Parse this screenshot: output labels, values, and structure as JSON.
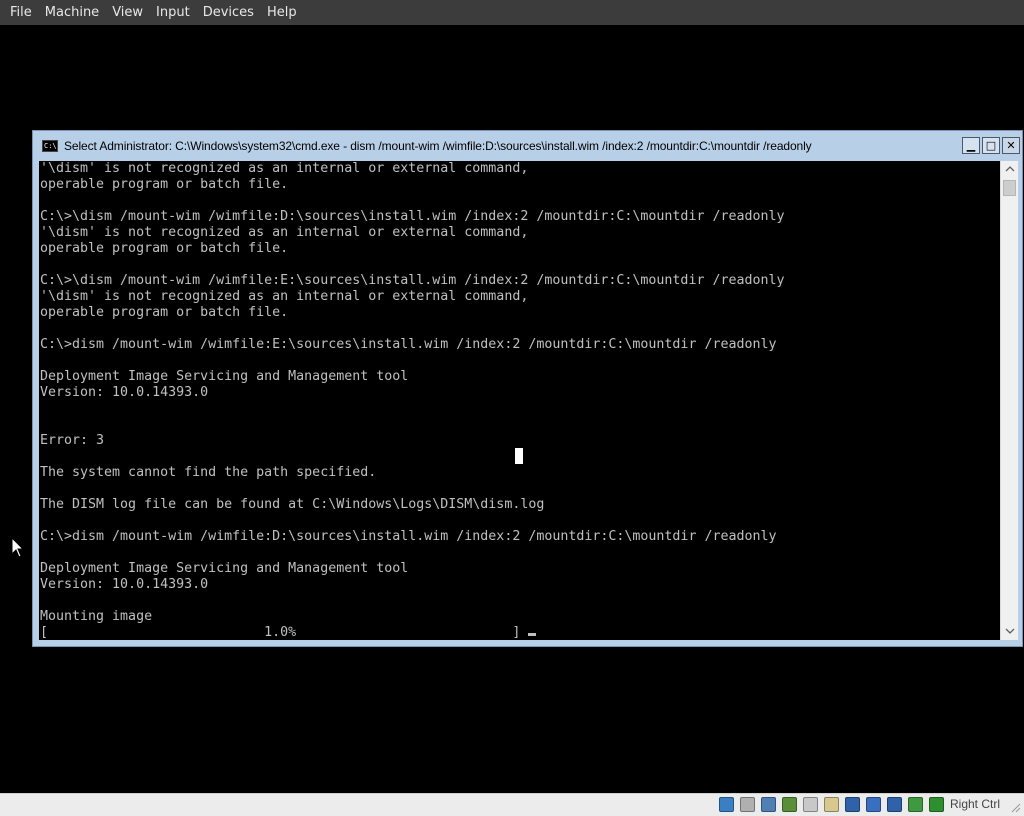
{
  "menubar": {
    "items": [
      "File",
      "Machine",
      "View",
      "Input",
      "Devices",
      "Help"
    ]
  },
  "cmd_window": {
    "title": "Select Administrator: C:\\Windows\\system32\\cmd.exe - dism  /mount-wim /wimfile:D:\\sources\\install.wim /index:2 /mountdir:C:\\mountdir /readonly",
    "icon_label": "C:\\",
    "buttons": {
      "minimize": "▁",
      "maximize": "□",
      "close": "✕"
    }
  },
  "console": {
    "lines": [
      "'\\dism' is not recognized as an internal or external command,",
      "operable program or batch file.",
      "",
      "C:\\>\\dism /mount-wim /wimfile:D:\\sources\\install.wim /index:2 /mountdir:C:\\mountdir /readonly",
      "'\\dism' is not recognized as an internal or external command,",
      "operable program or batch file.",
      "",
      "C:\\>\\dism /mount-wim /wimfile:E:\\sources\\install.wim /index:2 /mountdir:C:\\mountdir /readonly",
      "'\\dism' is not recognized as an internal or external command,",
      "operable program or batch file.",
      "",
      "C:\\>dism /mount-wim /wimfile:E:\\sources\\install.wim /index:2 /mountdir:C:\\mountdir /readonly",
      "",
      "Deployment Image Servicing and Management tool",
      "Version: 10.0.14393.0",
      "",
      "",
      "Error: 3",
      "",
      "The system cannot find the path specified.",
      "",
      "The DISM log file can be found at C:\\Windows\\Logs\\DISM\\dism.log",
      "",
      "C:\\>dism /mount-wim /wimfile:D:\\sources\\install.wim /index:2 /mountdir:C:\\mountdir /readonly",
      "",
      "Deployment Image Servicing and Management tool",
      "Version: 10.0.14393.0",
      "",
      "Mounting image"
    ],
    "progress_line": "[                           1.0%                           ]",
    "progress_percent": 1.0
  },
  "statusbar": {
    "host_key": "Right Ctrl",
    "icons": [
      {
        "name": "hard-disk-icon",
        "color": "#3a7fc4"
      },
      {
        "name": "optical-drive-icon",
        "color": "#b0b0b0"
      },
      {
        "name": "audio-icon",
        "color": "#4f7fb5"
      },
      {
        "name": "network-icon",
        "color": "#5a8f3a"
      },
      {
        "name": "usb-icon",
        "color": "#c8c8c8"
      },
      {
        "name": "shared-folders-icon",
        "color": "#d8c890"
      },
      {
        "name": "display-icon",
        "color": "#2f62a8"
      },
      {
        "name": "video-capture-icon",
        "color": "#3a6fbf"
      },
      {
        "name": "cpu-icon",
        "color": "#2f62a8"
      },
      {
        "name": "mouse-integration-icon",
        "color": "#3f9a3f"
      },
      {
        "name": "keyboard-capture-icon",
        "color": "#2f8f2f"
      }
    ]
  }
}
